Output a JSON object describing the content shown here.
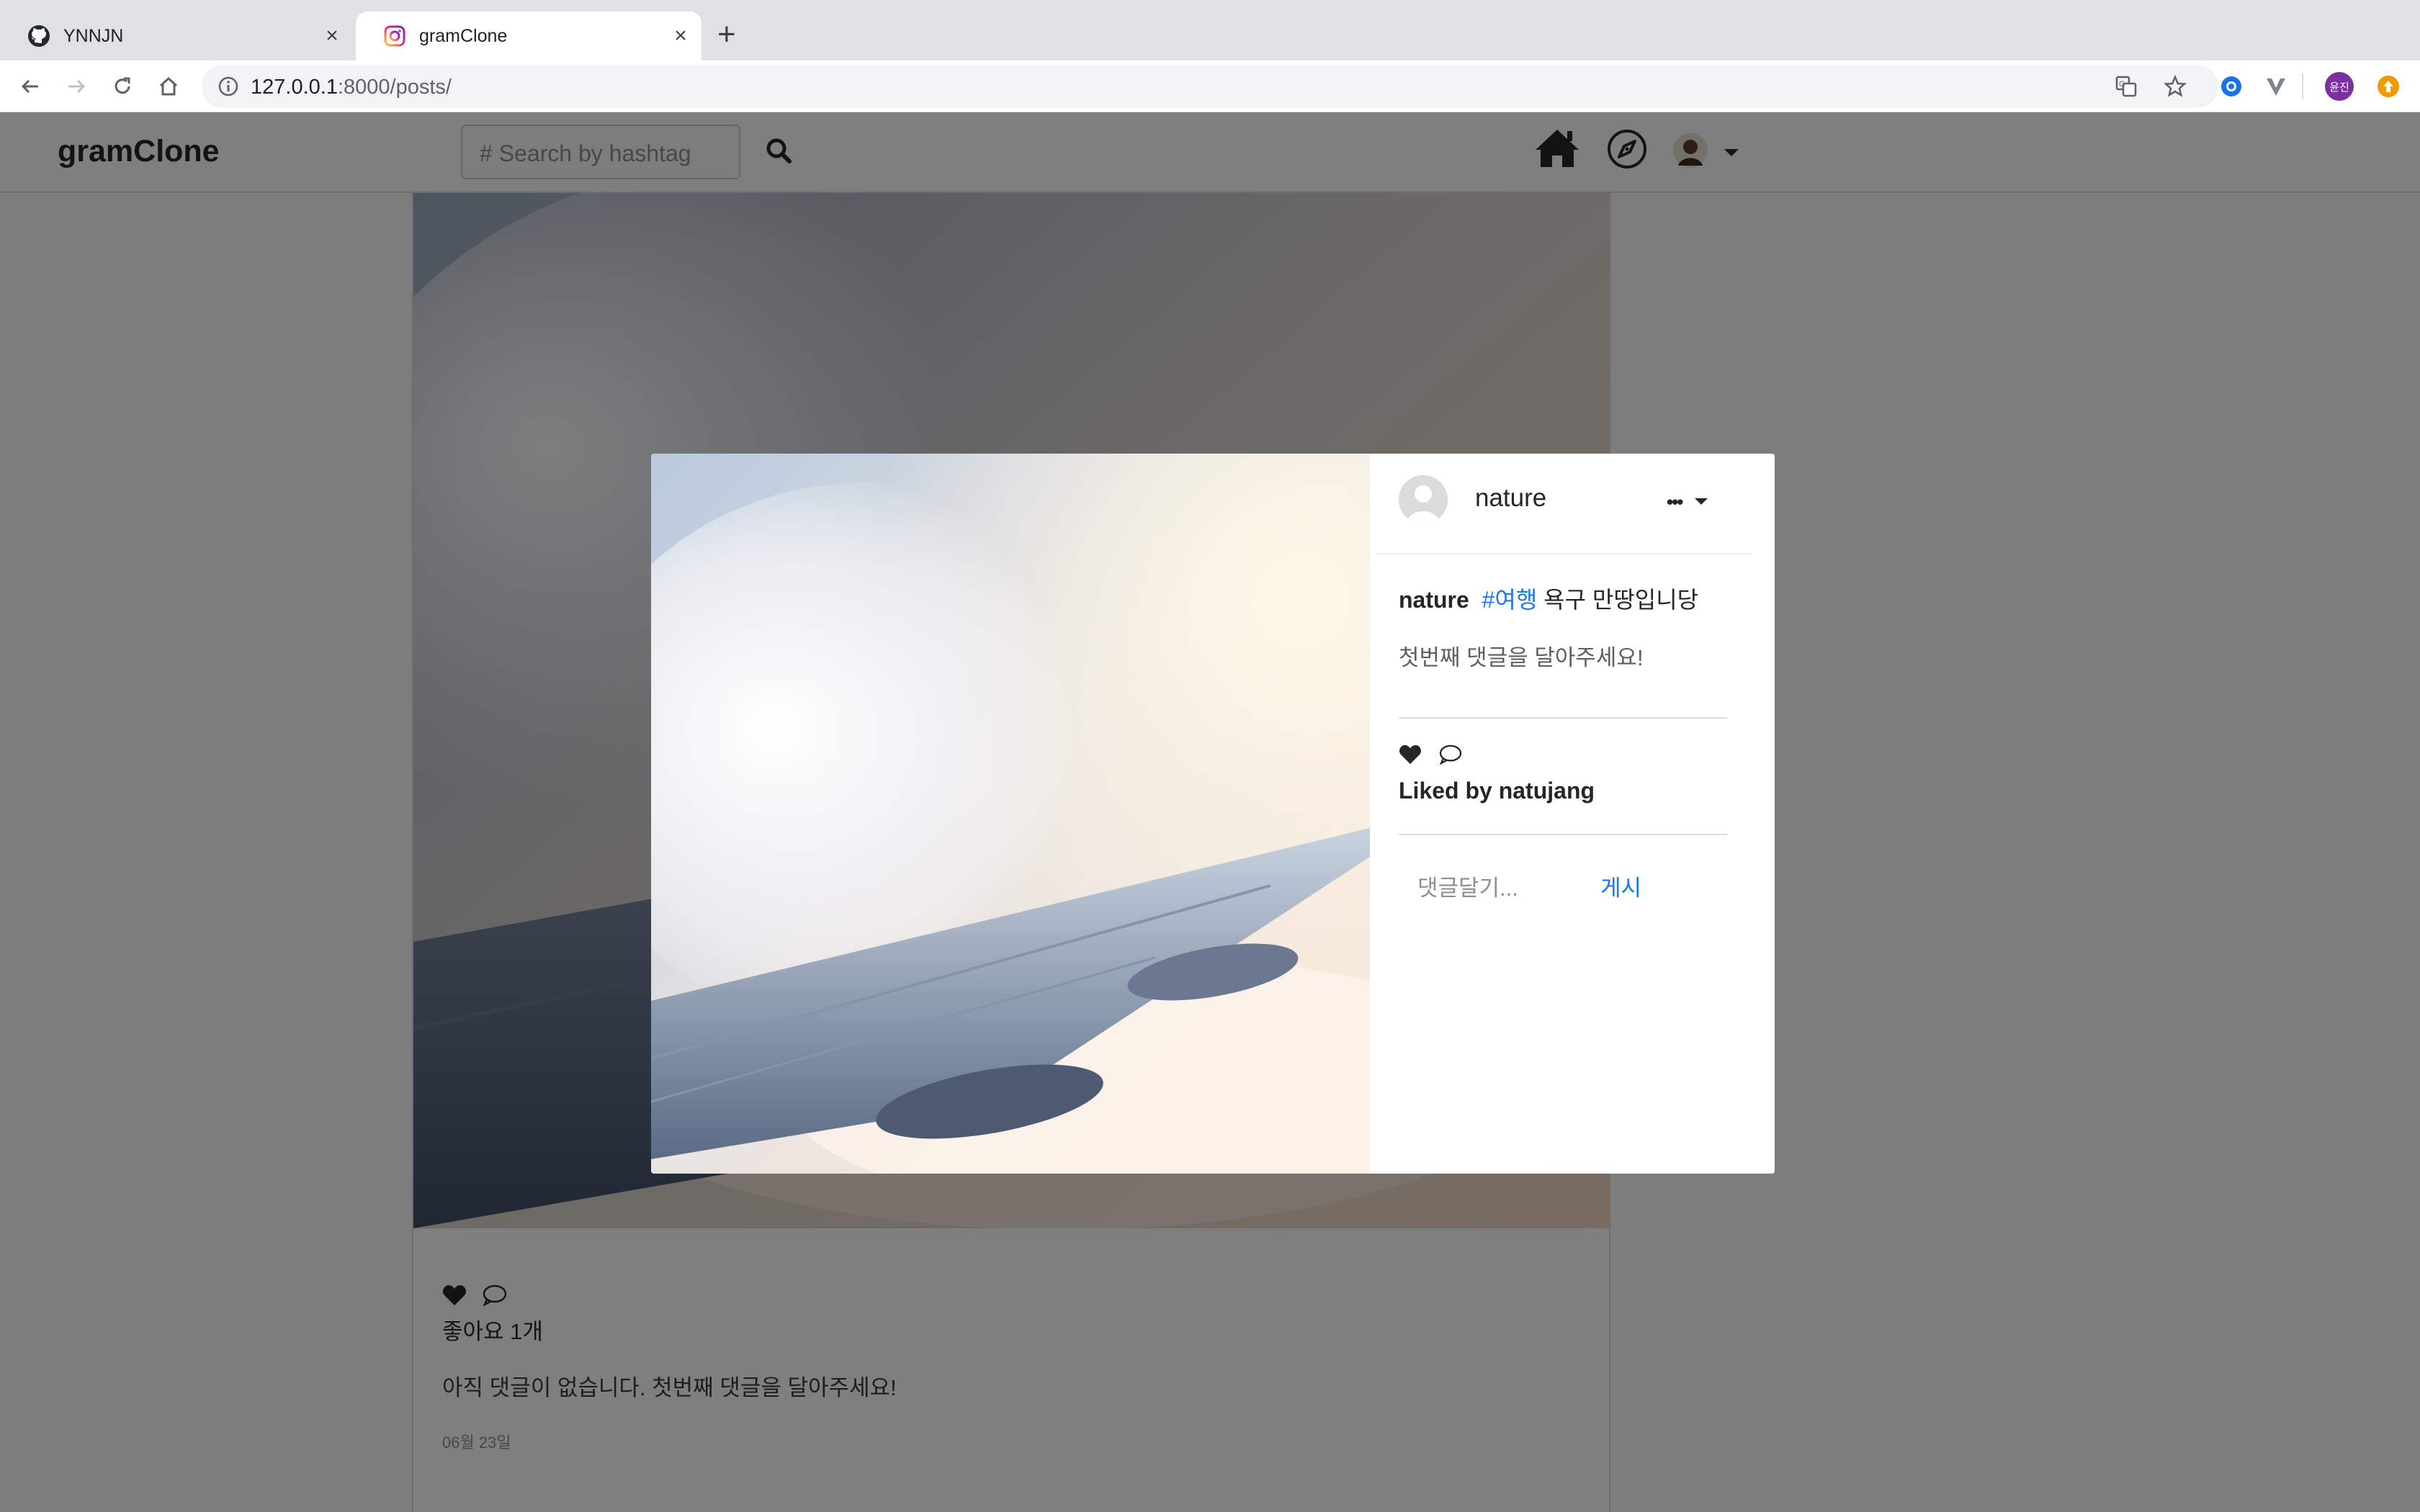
{
  "browser": {
    "tabs": [
      {
        "title": "YNNJN",
        "icon": "github-icon"
      },
      {
        "title": "gramClone",
        "icon": "instagram-icon"
      }
    ],
    "url_host": "127.0.0.1",
    "url_path": ":8000/posts/",
    "profile_initials": "윤진"
  },
  "app": {
    "brand": "gramClone",
    "search_placeholder": "# Search by hashtag"
  },
  "feed_post": {
    "likes_text": "좋아요 1개",
    "no_comments_text": "아직 댓글이 없습니다. 첫번째 댓글을 달아주세요!",
    "date": "06월 23일"
  },
  "modal": {
    "username": "nature",
    "more_label": "•••",
    "caption_user": "nature",
    "caption_tag": "#여행",
    "caption_text": "욕구 만땅입니당",
    "no_comments_text": "첫번째 댓글을 달아주세요!",
    "liked_by": "Liked by natujang",
    "comment_placeholder": "댓글달기...",
    "post_button": "게시"
  },
  "colors": {
    "link_blue": "#1877f2",
    "overlay": "rgba(0,0,0,0.5)",
    "profile_purple": "#7b2fa0"
  }
}
